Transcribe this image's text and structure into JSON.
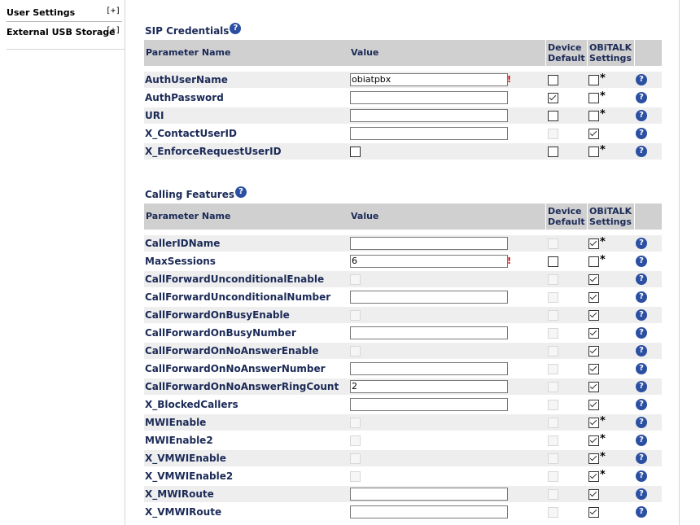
{
  "sidebar": {
    "items": [
      {
        "label": "User Settings",
        "expand": "[+]"
      },
      {
        "label": "External USB Storage",
        "expand": "[+]"
      }
    ]
  },
  "help_glyph": "?",
  "error_glyph": "!",
  "star_glyph": "*",
  "colors": {
    "header_bg": "#d0d0d0",
    "label_text": "#1b2a57",
    "row_shade": "#eeeeee",
    "help_icon": "#2b4fa2",
    "error": "#cc0000"
  },
  "sections": [
    {
      "title": "SIP Credentials",
      "headers": {
        "name": "Parameter Name",
        "value": "Value",
        "device_default": "Device Default",
        "obitalk": "OBiTALK Settings"
      },
      "rows": [
        {
          "name": "AuthUserName",
          "type": "text",
          "value": "obiatpbx",
          "error": true,
          "device_default": "unchecked",
          "obitalk": "unchecked",
          "star": true
        },
        {
          "name": "AuthPassword",
          "type": "text",
          "value": "",
          "error": false,
          "device_default": "checked",
          "obitalk": "unchecked",
          "star": true
        },
        {
          "name": "URI",
          "type": "text",
          "value": "",
          "error": false,
          "device_default": "unchecked",
          "obitalk": "unchecked",
          "star": true
        },
        {
          "name": "X_ContactUserID",
          "type": "text",
          "value": "",
          "error": false,
          "device_default": "disabled",
          "obitalk": "checked",
          "star": false
        },
        {
          "name": "X_EnforceRequestUserID",
          "type": "checkbox",
          "value": "unchecked",
          "error": false,
          "device_default": "unchecked",
          "obitalk": "unchecked",
          "star": true
        }
      ]
    },
    {
      "title": "Calling Features",
      "headers": {
        "name": "Parameter Name",
        "value": "Value",
        "device_default": "Device Default",
        "obitalk": "OBiTALK Settings"
      },
      "rows": [
        {
          "name": "CallerIDName",
          "type": "text",
          "value": "",
          "error": false,
          "device_default": "disabled",
          "obitalk": "checked",
          "star": true
        },
        {
          "name": "MaxSessions",
          "type": "text",
          "value": "6",
          "error": true,
          "device_default": "unchecked",
          "obitalk": "unchecked",
          "star": true
        },
        {
          "name": "CallForwardUnconditionalEnable",
          "type": "checkbox",
          "value": "disabled",
          "error": false,
          "device_default": "disabled",
          "obitalk": "checked",
          "star": false
        },
        {
          "name": "CallForwardUnconditionalNumber",
          "type": "text",
          "value": "",
          "error": false,
          "device_default": "disabled",
          "obitalk": "checked",
          "star": false
        },
        {
          "name": "CallForwardOnBusyEnable",
          "type": "checkbox",
          "value": "disabled",
          "error": false,
          "device_default": "disabled",
          "obitalk": "checked",
          "star": false
        },
        {
          "name": "CallForwardOnBusyNumber",
          "type": "text",
          "value": "",
          "error": false,
          "device_default": "disabled",
          "obitalk": "checked",
          "star": false
        },
        {
          "name": "CallForwardOnNoAnswerEnable",
          "type": "checkbox",
          "value": "disabled",
          "error": false,
          "device_default": "disabled",
          "obitalk": "checked",
          "star": false
        },
        {
          "name": "CallForwardOnNoAnswerNumber",
          "type": "text",
          "value": "",
          "error": false,
          "device_default": "disabled",
          "obitalk": "checked",
          "star": false
        },
        {
          "name": "CallForwardOnNoAnswerRingCount",
          "type": "text",
          "value": "2",
          "error": false,
          "device_default": "disabled",
          "obitalk": "checked",
          "star": false
        },
        {
          "name": "X_BlockedCallers",
          "type": "text",
          "value": "",
          "error": false,
          "device_default": "disabled",
          "obitalk": "checked",
          "star": false
        },
        {
          "name": "MWIEnable",
          "type": "checkbox",
          "value": "disabled",
          "error": false,
          "device_default": "disabled",
          "obitalk": "checked",
          "star": true
        },
        {
          "name": "MWIEnable2",
          "type": "checkbox",
          "value": "disabled",
          "error": false,
          "device_default": "disabled",
          "obitalk": "checked",
          "star": true
        },
        {
          "name": "X_VMWIEnable",
          "type": "checkbox",
          "value": "disabled",
          "error": false,
          "device_default": "disabled",
          "obitalk": "checked",
          "star": true
        },
        {
          "name": "X_VMWIEnable2",
          "type": "checkbox",
          "value": "disabled",
          "error": false,
          "device_default": "disabled",
          "obitalk": "checked",
          "star": true
        },
        {
          "name": "X_MWIRoute",
          "type": "text",
          "value": "",
          "error": false,
          "device_default": "disabled",
          "obitalk": "checked",
          "star": false
        },
        {
          "name": "X_VMWIRoute",
          "type": "text",
          "value": "",
          "error": false,
          "device_default": "disabled",
          "obitalk": "checked",
          "star": false
        }
      ]
    }
  ]
}
